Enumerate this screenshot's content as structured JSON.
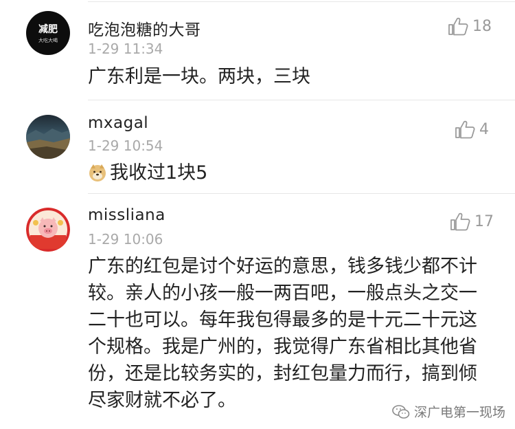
{
  "comments": [
    {
      "username": "吃泡泡糖的大哥",
      "timestamp": "1-29 11:34",
      "likes": "18",
      "text": "广东利是一块。两块，三块",
      "avatar_text": "减肥",
      "avatar_subtext": "大吃大喝",
      "avatar_bg": "#0d0d0d"
    },
    {
      "username": "mxagal",
      "timestamp": "1-29 10:54",
      "likes": "4",
      "emoji": "doge-icon",
      "text": "我收过1块5"
    },
    {
      "username": "missliana",
      "timestamp": "1-29 10:06",
      "likes": "17",
      "text": "广东的红包是讨个好运的意思，钱多钱少都不计较。亲人的小孩一般一两百吧，一般点头之交一二十也可以。每年我包得最多的是十元二十元这个规格。我是广州的，我觉得广东省相比其他省份，还是比较务实的，封红包量力而行，搞到倾尽家财就不必了。"
    }
  ],
  "watermark": {
    "label": "深广电第一现场",
    "icon": "wechat-icon"
  },
  "colors": {
    "username": "#222222",
    "timestamp": "#a9a9a9",
    "divider": "#e6e6e6",
    "like": "#9a9a9a"
  }
}
